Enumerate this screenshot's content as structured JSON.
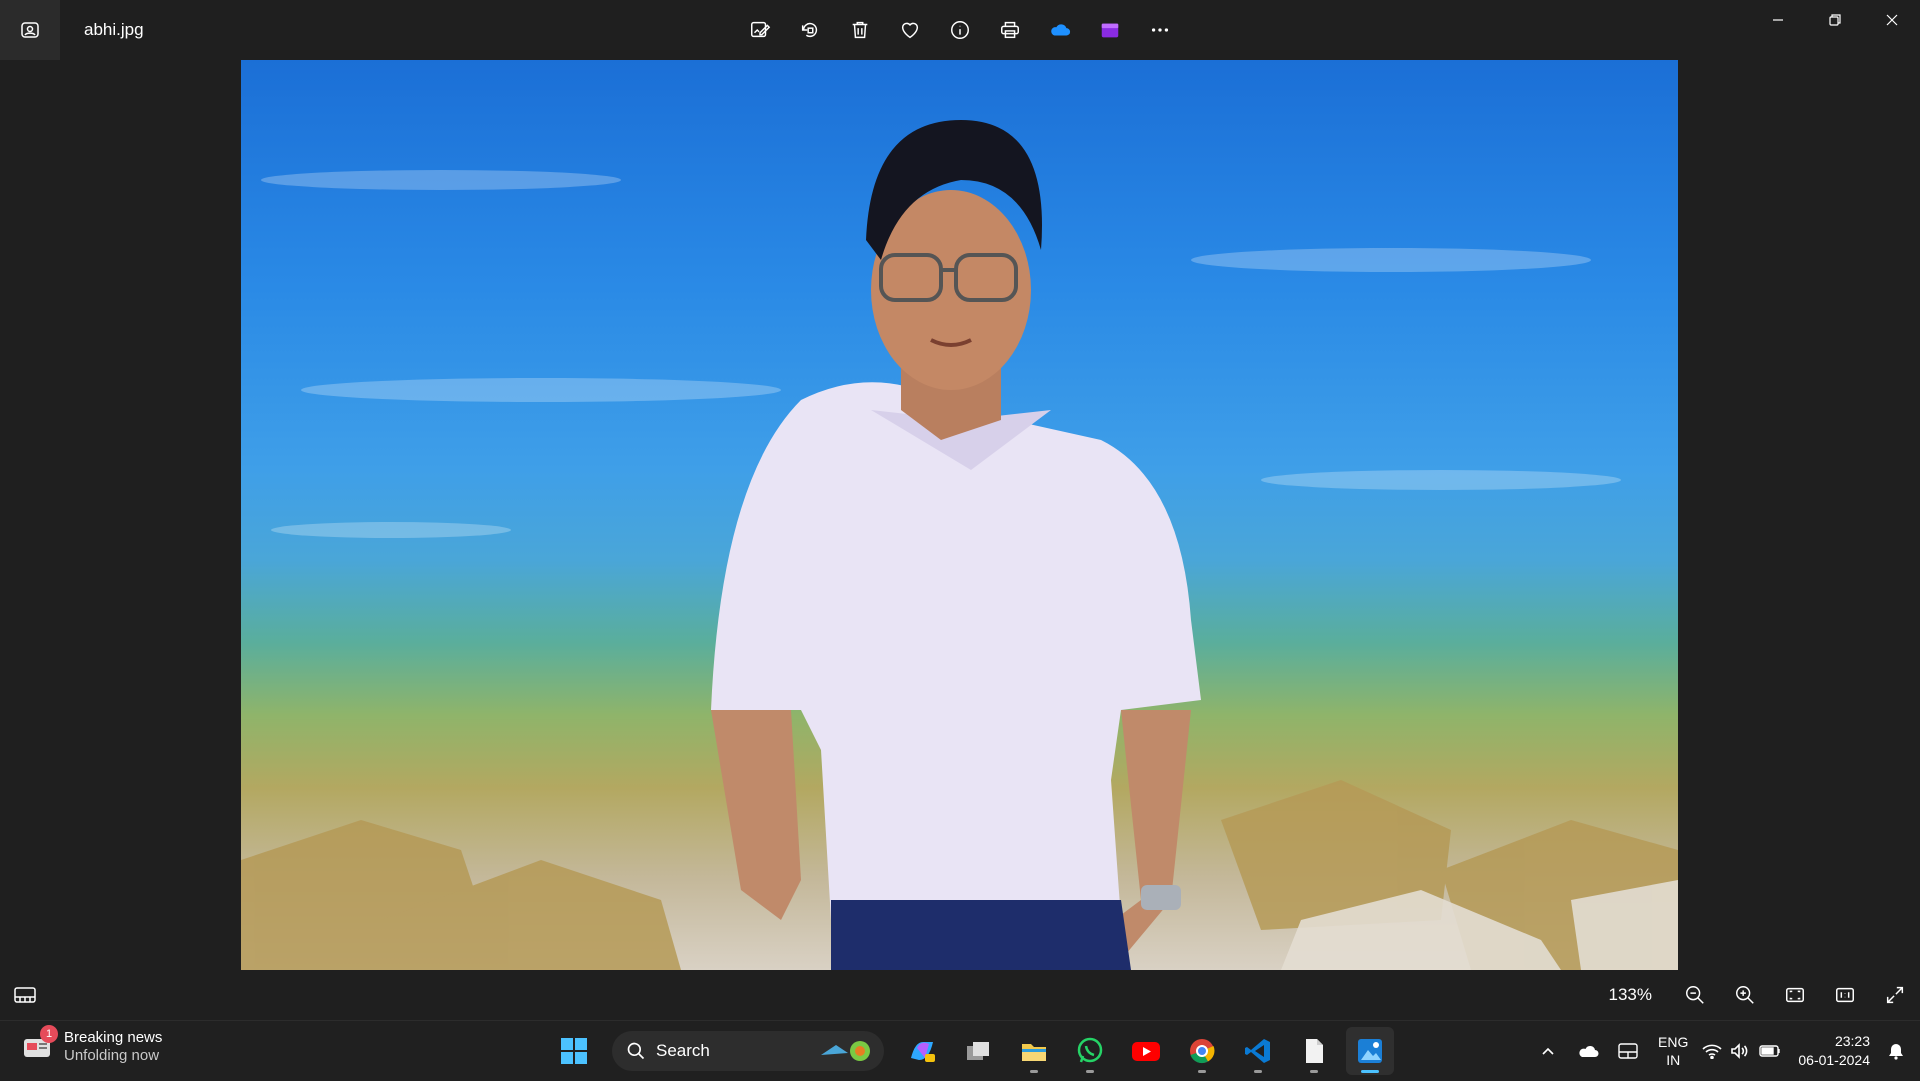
{
  "window": {
    "file_name": "abhi.jpg"
  },
  "toolbar": {
    "buttons": [
      "edit-image",
      "rotate",
      "delete",
      "favorite",
      "file-info",
      "print",
      "onedrive",
      "clipchamp",
      "more"
    ]
  },
  "viewer": {
    "zoom_level": "133%"
  },
  "taskbar": {
    "news": {
      "badge": "1",
      "title": "Breaking news",
      "subtitle": "Unfolding now"
    },
    "search": {
      "placeholder": "Search"
    },
    "language": {
      "line1": "ENG",
      "line2": "IN"
    },
    "clock": {
      "time": "23:23",
      "date": "06-01-2024"
    }
  },
  "colors": {
    "accent": "#4cc2ff",
    "background": "#1f1f1f",
    "taskbar": "#202020"
  }
}
